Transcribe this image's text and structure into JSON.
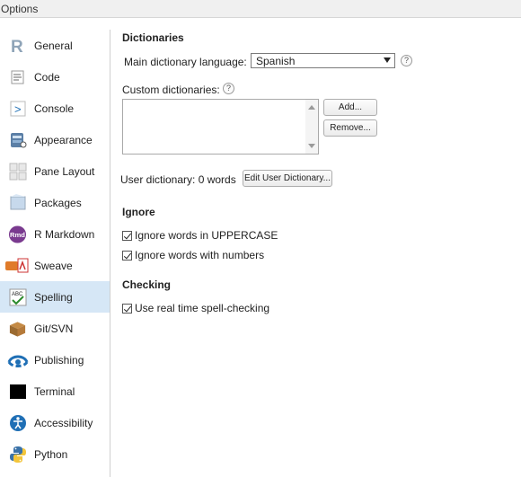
{
  "window": {
    "title": "Options"
  },
  "sidebar": {
    "items": [
      {
        "label": "General",
        "icon": "r-logo-icon"
      },
      {
        "label": "Code",
        "icon": "code-icon"
      },
      {
        "label": "Console",
        "icon": "console-icon"
      },
      {
        "label": "Appearance",
        "icon": "appearance-icon"
      },
      {
        "label": "Pane Layout",
        "icon": "pane-layout-icon"
      },
      {
        "label": "Packages",
        "icon": "packages-icon"
      },
      {
        "label": "R Markdown",
        "icon": "rmarkdown-icon",
        "badge": "Rmd"
      },
      {
        "label": "Sweave",
        "icon": "sweave-icon"
      },
      {
        "label": "Spelling",
        "icon": "spelling-icon",
        "selected": true,
        "badge": "ABC"
      },
      {
        "label": "Git/SVN",
        "icon": "git-icon"
      },
      {
        "label": "Publishing",
        "icon": "publishing-icon"
      },
      {
        "label": "Terminal",
        "icon": "terminal-icon"
      },
      {
        "label": "Accessibility",
        "icon": "accessibility-icon"
      },
      {
        "label": "Python",
        "icon": "python-icon"
      }
    ]
  },
  "dictionaries": {
    "title": "Dictionaries",
    "main_language_label": "Main dictionary language:",
    "main_language_value": "Spanish",
    "custom_label": "Custom dictionaries:",
    "add_button": "Add...",
    "remove_button": "Remove...",
    "user_dictionary_label": "User dictionary: 0 words",
    "edit_button": "Edit User Dictionary...",
    "help_glyph": "?"
  },
  "ignore": {
    "title": "Ignore",
    "uppercase_label": "Ignore words in UPPERCASE",
    "numbers_label": "Ignore words with numbers"
  },
  "checking": {
    "title": "Checking",
    "realtime_label": "Use real time spell-checking"
  },
  "colors": {
    "selected_bg": "#d6e7f6",
    "accent": "#1f6fb5"
  }
}
